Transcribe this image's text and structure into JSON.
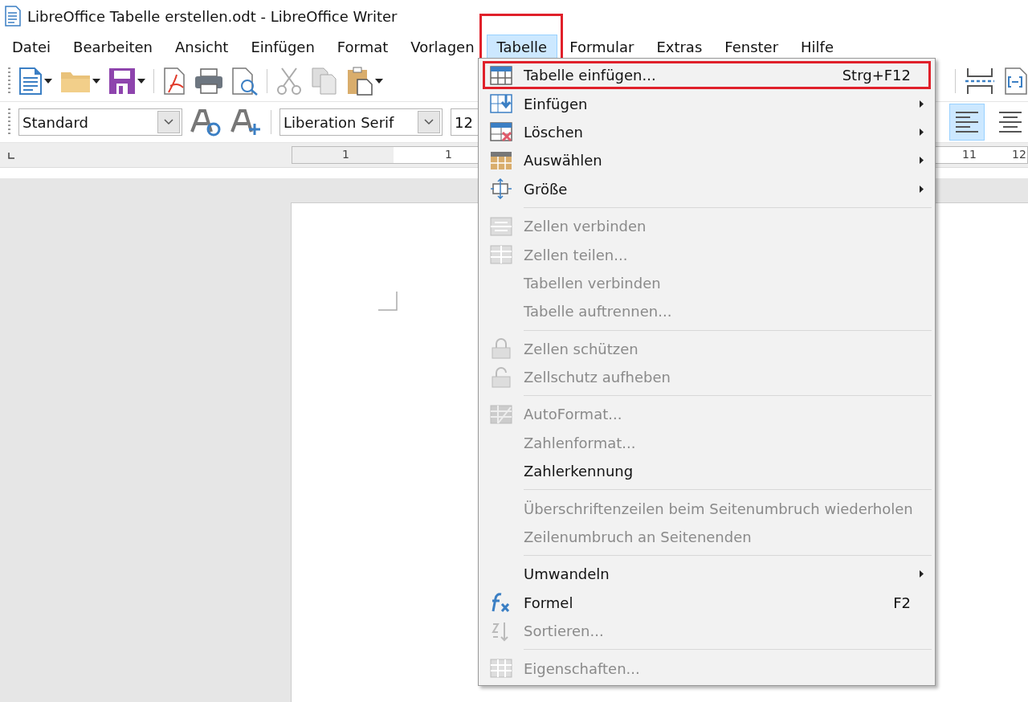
{
  "window": {
    "title": "LibreOffice Tabelle erstellen.odt - LibreOffice Writer"
  },
  "menu_bar": [
    {
      "label": "Datei",
      "selected": false,
      "highlighted": false
    },
    {
      "label": "Bearbeiten",
      "selected": false,
      "highlighted": false
    },
    {
      "label": "Ansicht",
      "selected": false,
      "highlighted": false
    },
    {
      "label": "Einfügen",
      "selected": false,
      "highlighted": false
    },
    {
      "label": "Format",
      "selected": false,
      "highlighted": false
    },
    {
      "label": "Vorlagen",
      "selected": false,
      "highlighted": false
    },
    {
      "label": "Tabelle",
      "selected": true,
      "highlighted": true
    },
    {
      "label": "Formular",
      "selected": false,
      "highlighted": false
    },
    {
      "label": "Extras",
      "selected": false,
      "highlighted": false
    },
    {
      "label": "Fenster",
      "selected": false,
      "highlighted": false
    },
    {
      "label": "Hilfe",
      "selected": false,
      "highlighted": false
    }
  ],
  "format_toolbar": {
    "paragraph_style": "Standard",
    "font_name": "Liberation Serif",
    "font_size": "12",
    "align_buttons": [
      {
        "selected": true
      },
      {
        "selected": false
      }
    ]
  },
  "ruler": {
    "labels": [
      "1",
      "1",
      "11",
      "12"
    ]
  },
  "table_menu": {
    "items": [
      {
        "kind": "item",
        "label": "Tabelle einfügen...",
        "shortcut": "Strg+F12",
        "submenu": false,
        "disabled": false,
        "highlighted": true
      },
      {
        "kind": "item",
        "label": "Einfügen",
        "submenu": true,
        "disabled": false,
        "highlighted": false
      },
      {
        "kind": "item",
        "label": "Löschen",
        "submenu": true,
        "disabled": false,
        "highlighted": false
      },
      {
        "kind": "item",
        "label": "Auswählen",
        "submenu": true,
        "disabled": false,
        "highlighted": false
      },
      {
        "kind": "item",
        "label": "Größe",
        "submenu": true,
        "disabled": false,
        "highlighted": false
      },
      {
        "kind": "separator"
      },
      {
        "kind": "item",
        "label": "Zellen verbinden",
        "submenu": false,
        "disabled": true,
        "highlighted": false
      },
      {
        "kind": "item",
        "label": "Zellen teilen...",
        "submenu": false,
        "disabled": true,
        "highlighted": false
      },
      {
        "kind": "item",
        "label": "Tabellen verbinden",
        "submenu": false,
        "disabled": true,
        "highlighted": false
      },
      {
        "kind": "item",
        "label": "Tabelle auftrennen...",
        "submenu": false,
        "disabled": true,
        "highlighted": false
      },
      {
        "kind": "separator"
      },
      {
        "kind": "item",
        "label": "Zellen schützen",
        "submenu": false,
        "disabled": true,
        "highlighted": false
      },
      {
        "kind": "item",
        "label": "Zellschutz aufheben",
        "submenu": false,
        "disabled": true,
        "highlighted": false
      },
      {
        "kind": "separator"
      },
      {
        "kind": "item",
        "label": "AutoFormat...",
        "submenu": false,
        "disabled": true,
        "highlighted": false
      },
      {
        "kind": "item",
        "label": "Zahlenformat...",
        "submenu": false,
        "disabled": true,
        "highlighted": false
      },
      {
        "kind": "item",
        "label": "Zahlerkennung",
        "submenu": false,
        "disabled": false,
        "highlighted": false
      },
      {
        "kind": "separator"
      },
      {
        "kind": "item",
        "label": "Überschriftenzeilen beim Seitenumbruch wiederholen",
        "submenu": false,
        "disabled": true,
        "highlighted": false
      },
      {
        "kind": "item",
        "label": "Zeilenumbruch an Seitenenden",
        "submenu": false,
        "disabled": true,
        "highlighted": false
      },
      {
        "kind": "separator"
      },
      {
        "kind": "item",
        "label": "Umwandeln",
        "submenu": true,
        "disabled": false,
        "highlighted": false
      },
      {
        "kind": "item",
        "label": "Formel",
        "shortcut": "F2",
        "submenu": false,
        "disabled": false,
        "highlighted": false
      },
      {
        "kind": "item",
        "label": "Sortieren...",
        "submenu": false,
        "disabled": true,
        "highlighted": false
      },
      {
        "kind": "separator"
      },
      {
        "kind": "item",
        "label": "Eigenschaften...",
        "submenu": false,
        "disabled": true,
        "highlighted": false
      }
    ]
  }
}
